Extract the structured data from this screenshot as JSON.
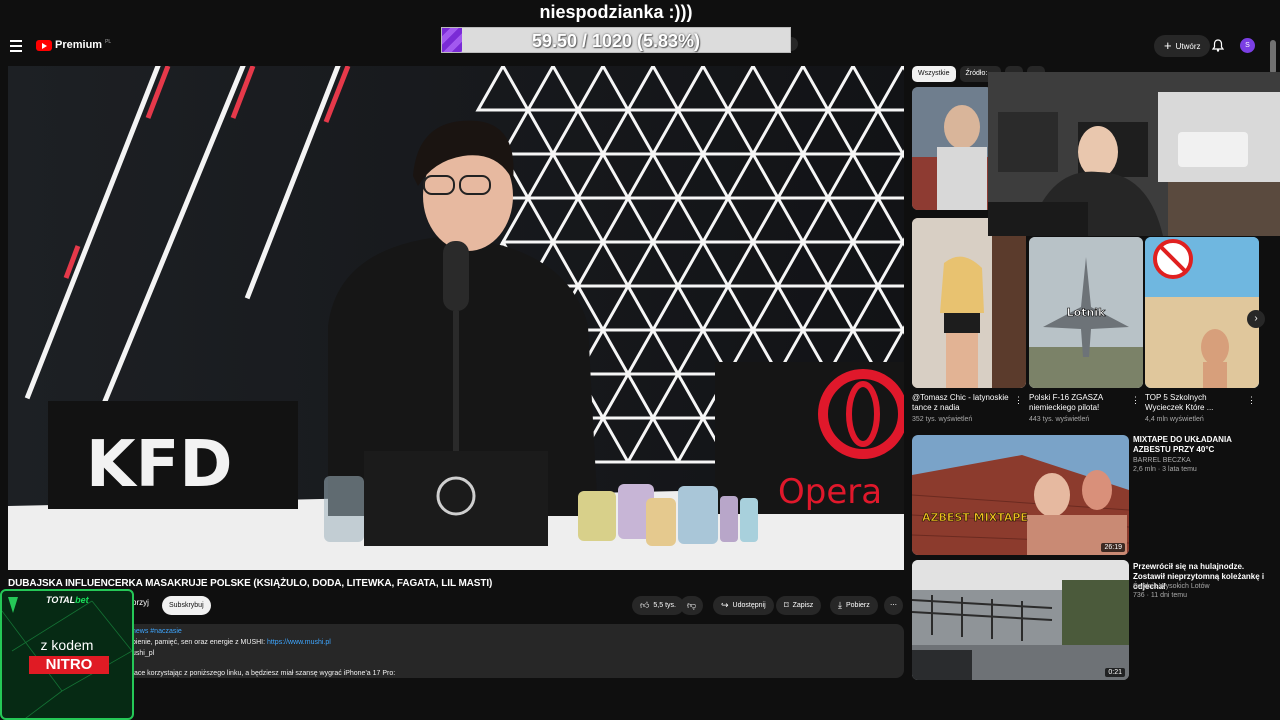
{
  "stream_overlay": {
    "goal_title": "niespodzianka :)))",
    "goal_progress_text": "59.50 / 1020 (5.83%)",
    "goal_fraction": 0.0583
  },
  "header": {
    "logo_text": "Premium",
    "logo_country": "PL",
    "create_label": "Utwórz",
    "avatar_letter": "S"
  },
  "player": {
    "brand_left": "KFD",
    "brand_right": "Opera"
  },
  "video": {
    "title": "DUBAJSKA INFLUENCERKA MASAKRUJE POLSKE (KSIĄŻULO, DODA, LITEWKA, FAGATA, LIL MASTI)",
    "join_label": "przyj",
    "subscribe_label": "Subskrybuj",
    "likes": "5,5 tys.",
    "share_label": "Udostępnij",
    "save_label": "Zapisz",
    "download_label": "Pobierz"
  },
  "description": {
    "hashtags": "news #naczasie",
    "line1_text": "pienie, pamięć, sen oraz energie z MUSHI: ",
    "line1_link": "https://www.mushi.pl",
    "line2": "ushi_pl",
    "line3": "tace korzystając z poniższego linku, a będziesz miał szansę wygrać iPhone'a 17 Pro:"
  },
  "sidebar": {
    "chips": [
      "Wszystkie",
      "Źródło: ...",
      "...",
      "...",
      "...",
      "..."
    ],
    "shorts": [
      {
        "title": "@Tomasz Chic - latynoskie tance z nadia",
        "views": "352 tys. wyświetleń"
      },
      {
        "title": "Polski F-16 ZGASZA niemieckiego pilota!",
        "views": "443 tys. wyświetleń",
        "overlay": "Lotnik"
      },
      {
        "title": "TOP 5 Szkolnych Wycieczek Które ...",
        "views": "4,4 mln wyświetleń"
      }
    ],
    "recommended": [
      {
        "title": "MIXTAPE DO UKŁADANIA AZBESTU PRZY 40°C",
        "channel": "BARREL BECZKA",
        "meta": "2,6 mln · 3 lata temu",
        "duration": "26:19",
        "thumb_text": "AZBEST MIXTAPE"
      },
      {
        "title": "Przewrócił się na hulajnodze. Zostawił nieprzytomną koleżankę i odjechał",
        "channel": "Świdnik Wysokich Lotów",
        "meta": "736 · 11 dni temu",
        "duration": "0:21"
      }
    ]
  },
  "promo": {
    "brand_a": "TOTAL",
    "brand_b": "bet",
    "line1": "z kodem",
    "code": "NITRO"
  }
}
